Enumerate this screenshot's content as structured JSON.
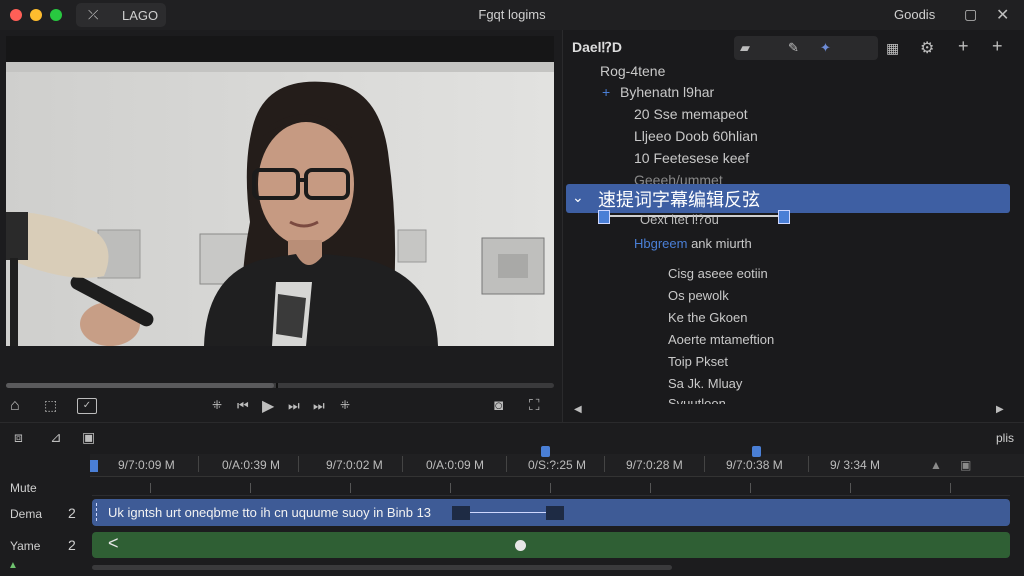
{
  "window": {
    "tab_label": "LAGO",
    "title": "Fgqt logims",
    "right_label": "Goodis"
  },
  "viewer_controls": {
    "icons": [
      "home-icon",
      "adjust-icon",
      "check-box-icon",
      "rewind-icon",
      "step-back-icon",
      "play-icon",
      "step-forward-icon",
      "skip-icon",
      "forward-icon",
      "snapshot-icon",
      "fullscreen-icon"
    ]
  },
  "inspector": {
    "header": "Dael⁉D",
    "tree": [
      {
        "label": "Rog-4tene"
      },
      {
        "label": "Byhenatn l9har",
        "prefix": "+"
      },
      {
        "label": "20 Sse memapeot"
      },
      {
        "label": "Lljeeo Doob 60hlian"
      },
      {
        "label": "10 Feetesese keef"
      },
      {
        "label": "Geeeh/ummet"
      }
    ],
    "selected": "速提词字幕编辑反弦",
    "sub_node": "Oext ltet l⁉ou",
    "group": {
      "link": "Hbgreem",
      "rest": " ank miurth"
    },
    "children": [
      "Cisg aseee eotiin",
      "Os pewolk",
      "Ke the Gkoen",
      "Aoerte mtameftion",
      "Toip Pkset",
      "Sa Jk. Mluay",
      "Svuutloon"
    ]
  },
  "timeline": {
    "right_label": "plis",
    "ticks": [
      "9/7:0:09 M",
      "0/A:0:39 M",
      "9/7:0:02 M",
      "0/A:0:09 M",
      "0/S:?:25 M",
      "9/7:0:28 M",
      "9/7:0:38 M",
      "9/ 3:34 M"
    ],
    "tracks": [
      {
        "name": "Mute",
        "num": ""
      },
      {
        "name": "Dema",
        "num": "2"
      },
      {
        "name": "Yame",
        "num": "2"
      }
    ],
    "caption_clip": "Uk igntsh urt oneqbme tto ih cn uquume suoy in Binb 13",
    "audio_marker": "<"
  },
  "colors": {
    "selection": "#3e5fa3",
    "caption_clip": "#3e5b96",
    "audio_clip": "#2f5f34",
    "playhead": "#4a7fd6"
  }
}
